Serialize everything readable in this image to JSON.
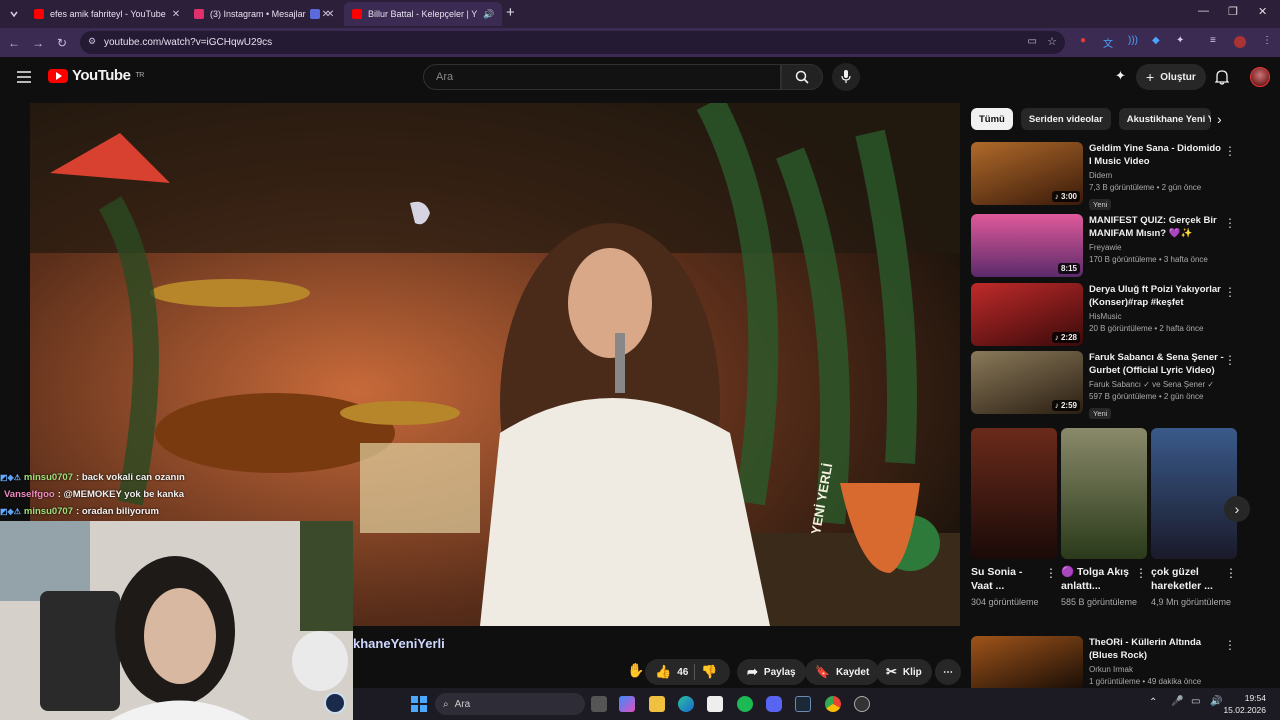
{
  "browser": {
    "tabs": [
      {
        "title": "efes amik fahriteyl - YouTube",
        "color": "#ff0000"
      },
      {
        "title": "(3) Instagram • Mesajlar",
        "color": "#e1306c"
      },
      {
        "title": "",
        "color": "#5b6bdc"
      },
      {
        "title": "Billur Battal - Kelepçeler | Y",
        "color": "#ff0000"
      }
    ],
    "new_tab_icon": "plus-icon",
    "url": "youtube.com/watch?v=iGCHqwU29cs",
    "window_controls": [
      "minimize-icon",
      "restore-icon",
      "close-icon"
    ]
  },
  "youtube": {
    "logo_text": "YouTube",
    "logo_region": "TR",
    "search_placeholder": "Ara",
    "create_label": "Oluştur",
    "accent": "#ff0000"
  },
  "player": {
    "overlay_text": "YENİ YERLİ",
    "chat": [
      {
        "user": "minsu0707",
        "message": ": back vokali can ozanın",
        "badges": true
      },
      {
        "user": "Vanselfgoo",
        "message": ": @MEMOKEY yok be kanka",
        "badges": false
      },
      {
        "user": "minsu0707",
        "message": ": oradan biliyorum",
        "badges": true
      }
    ]
  },
  "below_video": {
    "channel_fragment": "khaneYeniYerli",
    "likes": "46",
    "share_label": "Paylaş",
    "save_label": "Kaydet",
    "clip_label": "Klip"
  },
  "sidebar": {
    "chips": [
      "Tümü",
      "Seriden videolar",
      "Akustikhane Yeni Yerli"
    ],
    "recommendations": [
      {
        "title": "Geldim Yine Sana - Didomido I Music Video",
        "channel": "Didem",
        "stats": "7,3 B görüntüleme • 2 gün önce",
        "duration": "3:00",
        "badge": "Yeni",
        "thumb": "#7a3a1a"
      },
      {
        "title": "MANIFEST QUIZ: Gerçek Bir MANIFAM Mısın? 💜✨",
        "channel": "Freyawie",
        "stats": "170 B görüntüleme • 3 hafta önce",
        "duration": "8:15",
        "badge": "",
        "thumb": "#c04a8a"
      },
      {
        "title": "Derya Uluğ ft Poizi Yakıyorlar (Konser)#rap #keşfet #trendin...",
        "channel": "HisMusic",
        "stats": "20 B görüntüleme • 2 hafta önce",
        "duration": "2:28",
        "badge": "",
        "thumb": "#8a1a1a"
      },
      {
        "title": "Faruk Sabancı & Sena Şener - Gurbet (Official Lyric Video)",
        "channel": "Faruk Sabancı ✓ ve Sena Şener ✓",
        "stats": "597 B görüntüleme • 2 gün önce",
        "duration": "2:59",
        "badge": "Yeni",
        "thumb": "#5a4a32"
      }
    ],
    "shorts": [
      {
        "title": "Su Sonia - Vaat ...",
        "views": "304 görüntüleme",
        "thumb": "#3a1a14"
      },
      {
        "title": "🟣 Tolga Akış anlattı...",
        "views": "585 B görüntüleme",
        "thumb": "#4a5a3a"
      },
      {
        "title": "çok güzel hareketler ...",
        "views": "4,9 Mn görüntüleme",
        "thumb": "#2a3a5a"
      }
    ],
    "next_rec": {
      "title": "TheORi - Küllerin Altında (Blues Rock)",
      "channel": "Orkun Irmak",
      "stats": "1 görüntüleme • 49 dakika önce"
    }
  },
  "taskbar": {
    "search_label": "Ara",
    "time": "19:54",
    "date": "15.02.2026"
  }
}
